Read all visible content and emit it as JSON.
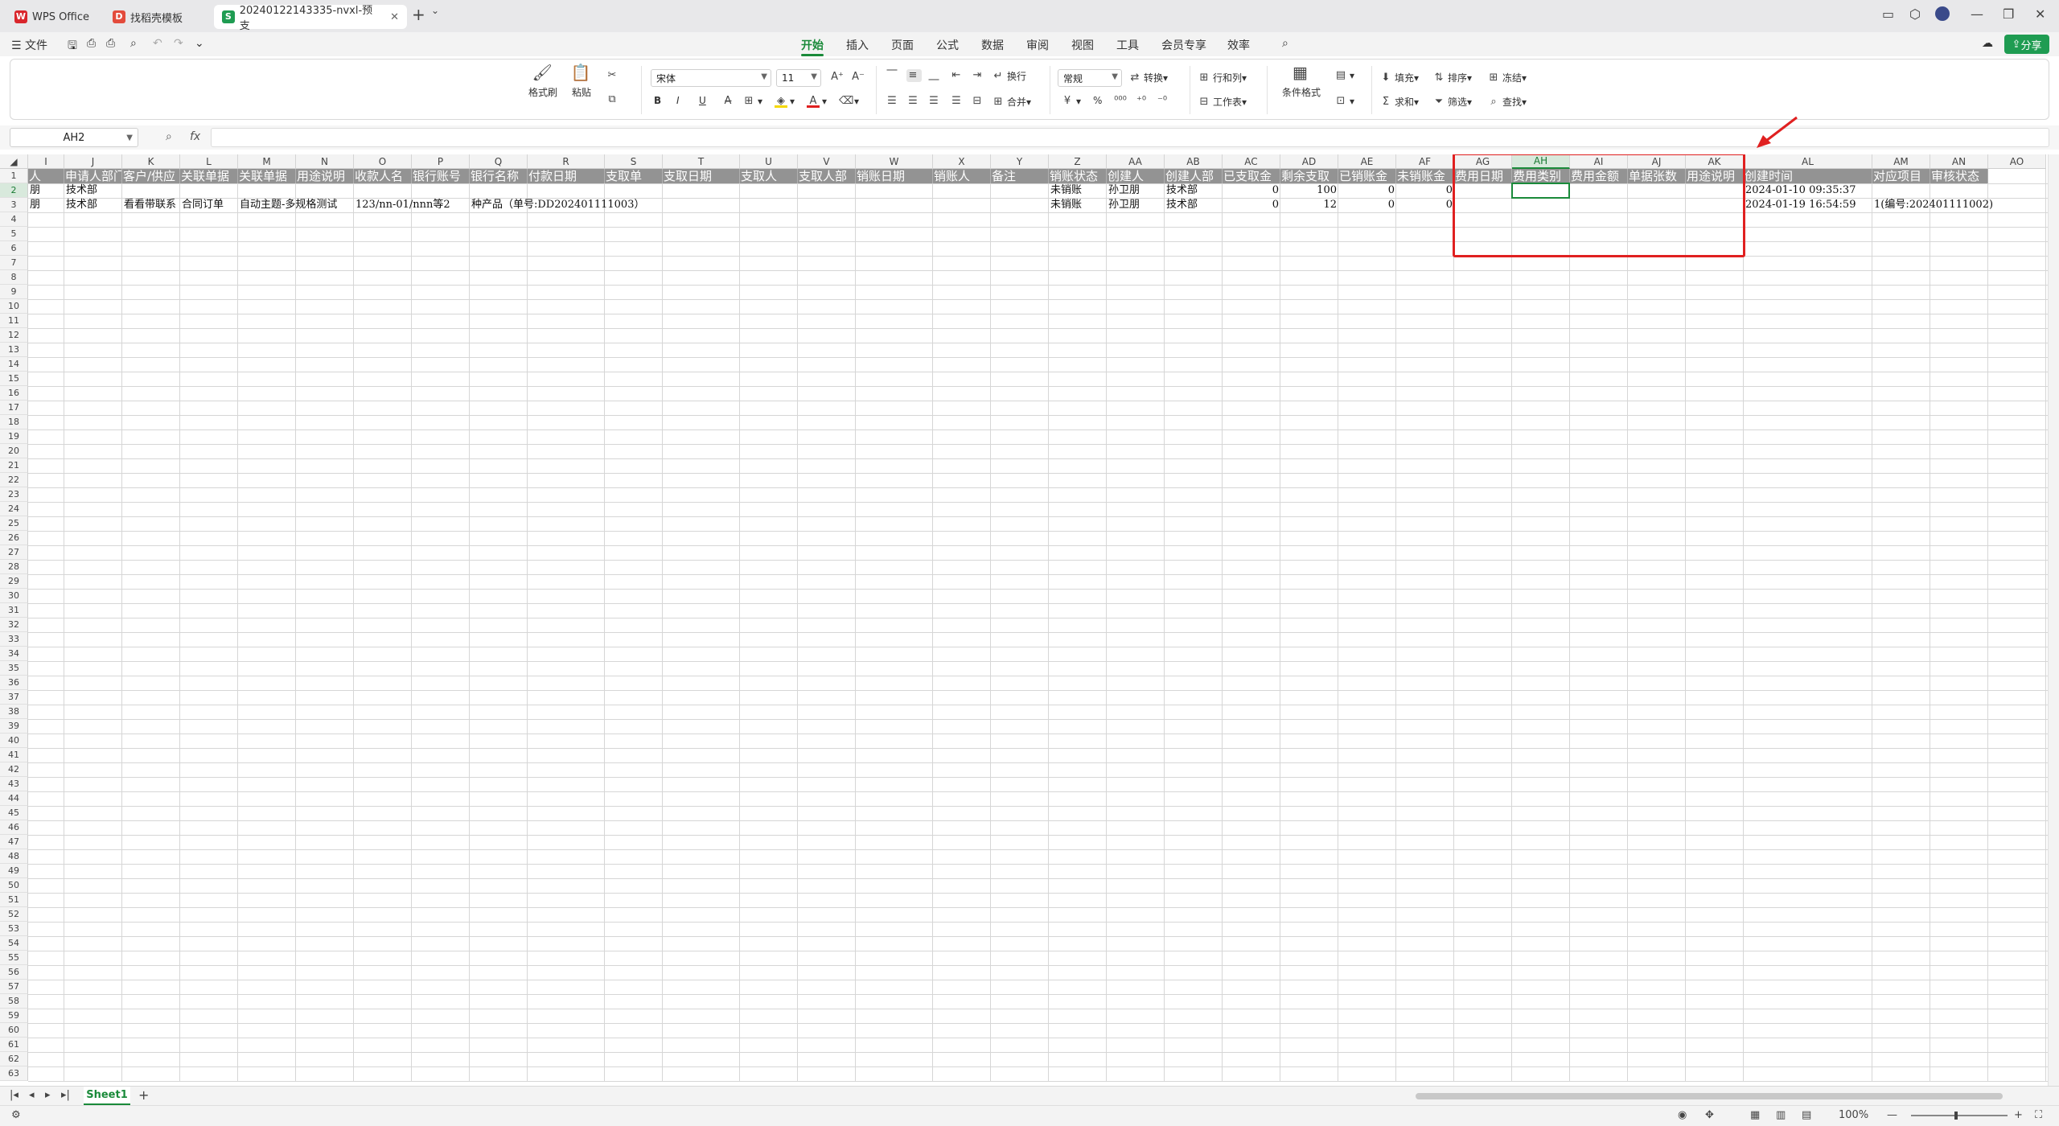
{
  "tabs": [
    {
      "label": "WPS Office",
      "color": "#d9262c",
      "glyph": "W"
    },
    {
      "label": "找稻壳模板",
      "color": "#e34b3c",
      "glyph": "D"
    },
    {
      "label": "20240122143335-nvxl-预支",
      "color": "#1f9c52",
      "glyph": "S"
    }
  ],
  "window": {
    "new_tab": "+",
    "tab_menu": "⌄",
    "minimize": "—",
    "restore": "❐",
    "close": "✕",
    "tab_close": "✕"
  },
  "menu": {
    "file": "文件",
    "items": [
      "开始",
      "插入",
      "页面",
      "公式",
      "数据",
      "审阅",
      "视图",
      "工具",
      "会员专享",
      "效率"
    ],
    "active": "开始",
    "share": "分享"
  },
  "ribbon": {
    "format_painter": "格式刷",
    "paste": "粘贴",
    "font_name": "宋体",
    "font_size": "11",
    "wrap": "换行",
    "merge": "合并",
    "number_format": "常规",
    "convert": "转换",
    "row_col": "行和列",
    "worksheet": "工作表",
    "cond_format": "条件格式",
    "fill": "填充",
    "sort": "排序",
    "freeze": "冻结",
    "sum": "求和",
    "filter": "筛选",
    "find": "查找",
    "bold": "B",
    "italic": "I",
    "underline": "U",
    "percent": "%"
  },
  "formula_bar": {
    "name_box": "AH2",
    "fx": "fx",
    "value": ""
  },
  "columns": [
    {
      "key": "I",
      "w": 45,
      "head": "人"
    },
    {
      "key": "J",
      "w": 72,
      "head": "申请人部门"
    },
    {
      "key": "K",
      "w": 72,
      "head": "客户/供应"
    },
    {
      "key": "L",
      "w": 72,
      "head": "关联单据"
    },
    {
      "key": "M",
      "w": 72,
      "head": "关联单据"
    },
    {
      "key": "N",
      "w": 72,
      "head": "用途说明"
    },
    {
      "key": "O",
      "w": 72,
      "head": "收款人名"
    },
    {
      "key": "P",
      "w": 72,
      "head": "银行账号"
    },
    {
      "key": "Q",
      "w": 72,
      "head": "银行名称"
    },
    {
      "key": "R",
      "w": 96,
      "head": "付款日期"
    },
    {
      "key": "S",
      "w": 72,
      "head": "支取单"
    },
    {
      "key": "T",
      "w": 96,
      "head": "支取日期"
    },
    {
      "key": "U",
      "w": 72,
      "head": "支取人"
    },
    {
      "key": "V",
      "w": 72,
      "head": "支取人部"
    },
    {
      "key": "W",
      "w": 96,
      "head": "销账日期"
    },
    {
      "key": "X",
      "w": 72,
      "head": "销账人"
    },
    {
      "key": "Y",
      "w": 72,
      "head": "备注"
    },
    {
      "key": "Z",
      "w": 72,
      "head": "销账状态"
    },
    {
      "key": "AA",
      "w": 72,
      "head": "创建人"
    },
    {
      "key": "AB",
      "w": 72,
      "head": "创建人部"
    },
    {
      "key": "AC",
      "w": 72,
      "head": "已支取金"
    },
    {
      "key": "AD",
      "w": 72,
      "head": "剩余支取"
    },
    {
      "key": "AE",
      "w": 72,
      "head": "已销账金"
    },
    {
      "key": "AF",
      "w": 72,
      "head": "未销账金"
    },
    {
      "key": "AG",
      "w": 72,
      "head": "费用日期"
    },
    {
      "key": "AH",
      "w": 72,
      "head": "费用类别"
    },
    {
      "key": "AI",
      "w": 72,
      "head": "费用金额"
    },
    {
      "key": "AJ",
      "w": 72,
      "head": "单据张数"
    },
    {
      "key": "AK",
      "w": 72,
      "head": "用途说明"
    },
    {
      "key": "AL",
      "w": 160,
      "head": "创建时间"
    },
    {
      "key": "AM",
      "w": 72,
      "head": "对应项目"
    },
    {
      "key": "AN",
      "w": 72,
      "head": "审核状态"
    },
    {
      "key": "AO",
      "w": 72,
      "head": ""
    }
  ],
  "rows": {
    "2": {
      "I": "朋",
      "J": "技术部",
      "Z": "未销账",
      "AA": "孙卫朋",
      "AB": "技术部",
      "AC": "0",
      "AD": "100",
      "AE": "0",
      "AF": "0",
      "AL": "2024-01-10 09:35:37"
    },
    "3": {
      "I": "朋",
      "J": "技术部",
      "K": "看看带联系",
      "L": "合同订单",
      "M": "自动主题-多规格测试",
      "O": "123/nn-01/nnn等2",
      "Q": "种产品（单号:DD202401111003）",
      "Z": "未销账",
      "AA": "孙卫朋",
      "AB": "技术部",
      "AC": "0",
      "AD": "12",
      "AE": "0",
      "AF": "0",
      "AL": "2024-01-19 16:54:59",
      "AM": "1(编号:202401111002)"
    }
  },
  "selected_cell": "AH2",
  "row_count": 63,
  "sheet": {
    "name": "Sheet1",
    "add": "+"
  },
  "status": {
    "zoom": "100%",
    "zoom_out": "—",
    "zoom_in": "+"
  },
  "colors": {
    "accent": "#1a8a3a",
    "annotation": "#e02020",
    "header_fill": "#939393"
  }
}
